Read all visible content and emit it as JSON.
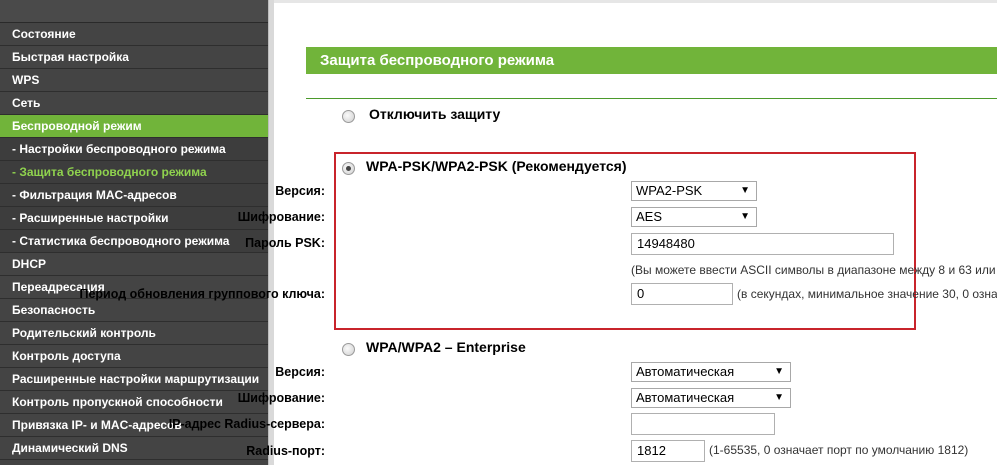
{
  "sidebar": {
    "items": [
      {
        "label": "Состояние",
        "type": "main"
      },
      {
        "label": "Быстрая настройка",
        "type": "main"
      },
      {
        "label": "WPS",
        "type": "main"
      },
      {
        "label": "Сеть",
        "type": "main"
      },
      {
        "label": "Беспроводной режим",
        "type": "main-active"
      },
      {
        "label": "- Настройки беспроводного режима",
        "type": "sub"
      },
      {
        "label": "- Защита беспроводного режима",
        "type": "sub-current"
      },
      {
        "label": "- Фильтрация MAC-адресов",
        "type": "sub"
      },
      {
        "label": "- Расширенные настройки",
        "type": "sub"
      },
      {
        "label": "- Статистика беспроводного режима",
        "type": "sub"
      },
      {
        "label": "DHCP",
        "type": "main"
      },
      {
        "label": "Переадресация",
        "type": "main"
      },
      {
        "label": "Безопасность",
        "type": "main"
      },
      {
        "label": "Родительский контроль",
        "type": "main"
      },
      {
        "label": "Контроль доступа",
        "type": "main"
      },
      {
        "label": "Расширенные настройки маршрутизации",
        "type": "main"
      },
      {
        "label": "Контроль пропускной способности",
        "type": "main"
      },
      {
        "label": "Привязка IP- и MAC-адресов",
        "type": "main"
      },
      {
        "label": "Динамический DNS",
        "type": "main"
      }
    ]
  },
  "page": {
    "title": "Защита беспроводного режима"
  },
  "options": {
    "disable": {
      "label": "Отключить защиту",
      "checked": false
    },
    "wpa_psk": {
      "label": "WPA-PSK/WPA2-PSK (Рекомендуется)",
      "checked": true,
      "version_label": "Версия:",
      "version_value": "WPA2-PSK",
      "encryption_label": "Шифрование:",
      "encryption_value": "AES",
      "password_label": "Пароль PSK:",
      "password_value": "14948480",
      "password_hint": "(Вы можете ввести ASCII символы в диапазоне между 8 и 63 или",
      "group_key_label": "Период обновления группового ключа:",
      "group_key_value": "0",
      "group_key_hint": "(в секундах, минимальное значение 30, 0 озна"
    },
    "enterprise": {
      "label": "WPA/WPA2 – Enterprise",
      "checked": false,
      "version_label": "Версия:",
      "version_value": "Автоматическая",
      "encryption_label": "Шифрование:",
      "encryption_value": "Автоматическая",
      "radius_ip_label": "IP-адрес Radius-сервера:",
      "radius_ip_value": "",
      "radius_port_label": "Radius-порт:",
      "radius_port_value": "1812",
      "radius_port_hint": "(1-65535, 0 означает порт по умолчанию 1812)"
    }
  },
  "icons": {
    "dropdown": "chevron-down-icon"
  },
  "colors": {
    "sidebar_bg": "#434343",
    "accent_green": "#71b43a",
    "current_sub_text": "#8fd24e",
    "highlight_red": "#c8242b"
  }
}
